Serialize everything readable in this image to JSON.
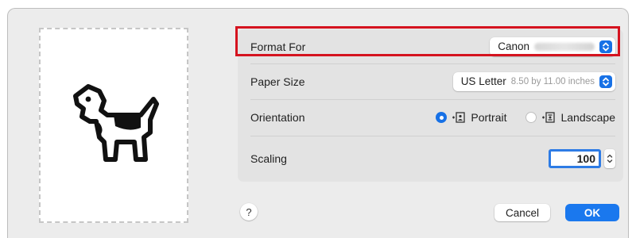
{
  "format_for": {
    "label": "Format For",
    "value": "Canon",
    "value_redacted": true
  },
  "paper_size": {
    "label": "Paper Size",
    "value": "US Letter",
    "detail": "8.50 by 11.00 inches"
  },
  "orientation": {
    "label": "Orientation",
    "options": [
      {
        "label": "Portrait",
        "selected": true,
        "icon": "portrait-icon"
      },
      {
        "label": "Landscape",
        "selected": false,
        "icon": "landscape-icon"
      }
    ]
  },
  "scaling": {
    "label": "Scaling",
    "value": "100"
  },
  "buttons": {
    "help": "?",
    "cancel": "Cancel",
    "ok": "OK"
  },
  "icons": {
    "preview": "dogcow-icon",
    "popup": "chevron-updown-icon",
    "stepper": "stepper-icon"
  },
  "colors": {
    "accent": "#1771e6",
    "highlight": "#d5131f",
    "panel": "#e3e3e3",
    "window": "#ececec"
  }
}
